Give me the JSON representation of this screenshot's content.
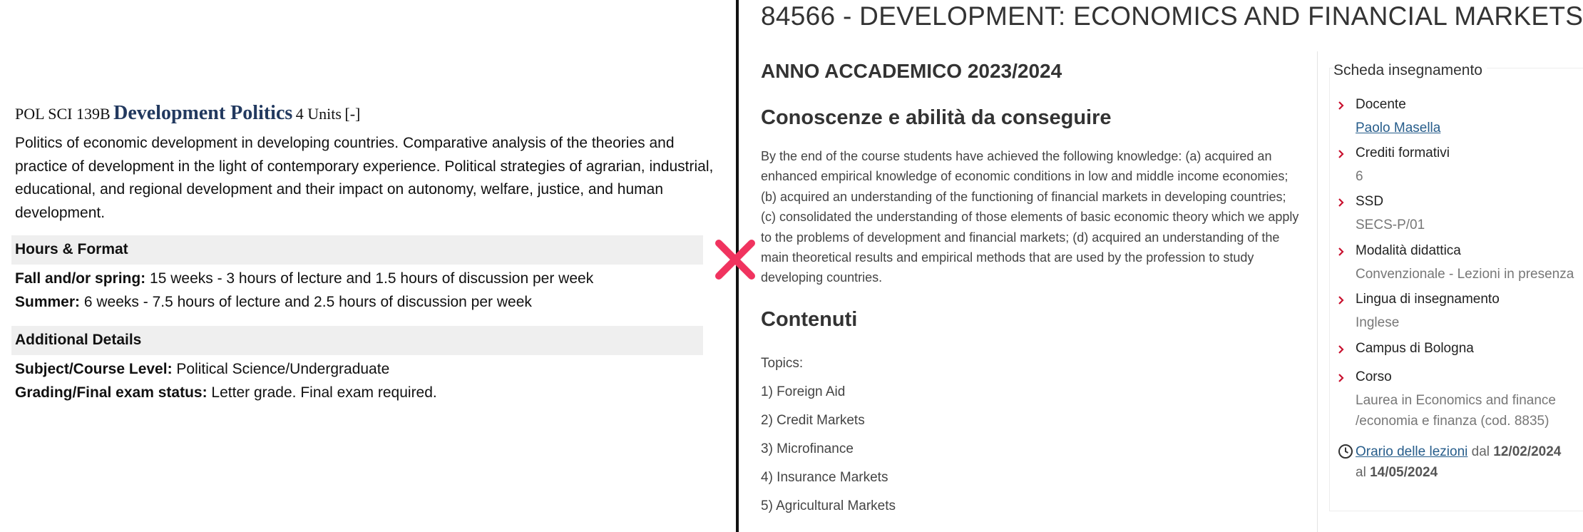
{
  "left": {
    "course": {
      "code": "POL SCI 139B",
      "title": "Development Politics",
      "units": "4 Units",
      "toggle": "[-]",
      "description": "Politics of economic development in developing countries. Comparative analysis of the theories and practice of development in the light of contemporary experience. Political strategies of agrarian, industrial, educational, and regional development and their impact on autonomy, welfare, justice, and human development."
    },
    "hours_format": {
      "heading": "Hours & Format",
      "fall_spring_label": "Fall and/or spring:",
      "fall_spring_value": "15 weeks - 3 hours of lecture and 1.5 hours of discussion per week",
      "summer_label": "Summer:",
      "summer_value": "6 weeks - 7.5 hours of lecture and 2.5 hours of discussion per week"
    },
    "additional_details": {
      "heading": "Additional Details",
      "level_label": "Subject/Course Level:",
      "level_value": "Political Science/Undergraduate",
      "grading_label": "Grading/Final exam status:",
      "grading_value": "Letter grade. Final exam required."
    }
  },
  "divider": {
    "mark_icon": "x-mark-icon",
    "mark_color": "#f0335f"
  },
  "right": {
    "page_title": "84566 - DEVELOPMENT: ECONOMICS AND FINANCIAL MARKETS",
    "academic_year": "ANNO ACCADEMICO 2023/2024",
    "knowledge": {
      "heading": "Conoscenze e abilità da conseguire",
      "text": "By the end of the course students have achieved the following knowledge: (a) acquired an enhanced empirical knowledge of economic conditions in low and middle income economies; (b) acquired an understanding of the functioning of financial markets in developing countries; (c) consolidated the understanding of those elements of basic economic theory which we apply to the problems of development and financial markets; (d) acquired an understanding of the main theoretical results and empirical methods that are used by the profession to study developing countries."
    },
    "contents": {
      "heading": "Contenuti",
      "topics_label": "Topics:",
      "topics": [
        "1) Foreign Aid",
        "2) Credit Markets",
        "3) Microfinance",
        "4) Insurance Markets",
        "5) Agricultural Markets"
      ]
    },
    "sidebar": {
      "title": "Scheda insegnamento",
      "items": [
        {
          "label": "Docente",
          "value": "Paolo Masella"
        },
        {
          "label": "Crediti formativi",
          "value": "6"
        },
        {
          "label": "SSD",
          "value": "SECS-P/01"
        },
        {
          "label": "Modalità didattica",
          "value": "Convenzionale - Lezioni in presenza"
        },
        {
          "label": "Lingua di insegnamento",
          "value": "Inglese"
        },
        {
          "label": "Campus di Bologna"
        },
        {
          "label": "Corso",
          "value_line1": "Laurea in Economics and finance",
          "value_line2": "/economia e finanza (cod. 8835)"
        }
      ],
      "schedule": {
        "link": "Orario delle lezioni",
        "from_word": "dal",
        "from_date": "12/02/2024",
        "to_word": "al",
        "to_date": "14/05/2024"
      },
      "arrow_color": "#c8102e",
      "link_color": "#275d8b"
    }
  }
}
